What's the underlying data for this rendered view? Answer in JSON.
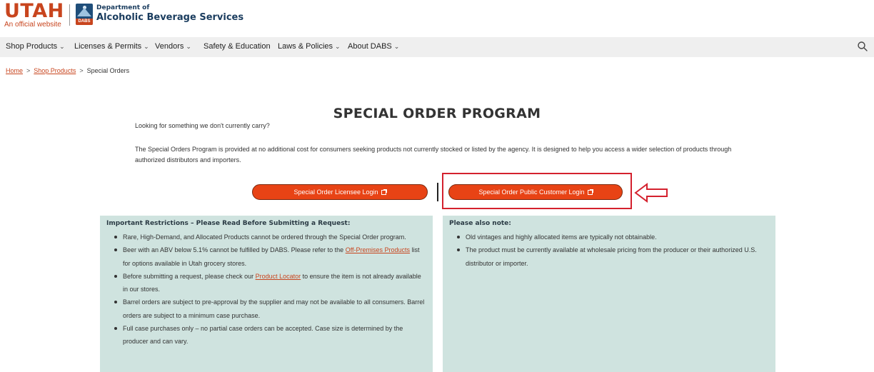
{
  "header": {
    "utah_logo_text": "UTAH",
    "utah_logo_sub": "An official website",
    "dabs_badge_text": "DABS",
    "dept_line1": "Department of",
    "dept_line2": "Alcoholic Beverage Services"
  },
  "nav": {
    "items": [
      {
        "label": "Shop Products",
        "has_dropdown": true
      },
      {
        "label": "Licenses & Permits",
        "has_dropdown": true
      },
      {
        "label": "Vendors",
        "has_dropdown": true
      },
      {
        "label": "Safety & Education",
        "has_dropdown": false
      },
      {
        "label": "Laws & Policies",
        "has_dropdown": true
      },
      {
        "label": "About DABS",
        "has_dropdown": true
      }
    ],
    "search_icon": "search-icon"
  },
  "breadcrumb": {
    "items": [
      "Home",
      "Shop Products",
      "Special Orders"
    ]
  },
  "main": {
    "title": "SPECIAL ORDER PROGRAM",
    "lead": "Looking for something we don't currently carry?",
    "intro": "The Special Orders Program is provided at no additional cost for consumers seeking products not currently stocked or listed by the agency. It is designed to help you access a wider selection of products through authorized distributors and importers."
  },
  "buttons": {
    "licensee_login": "Special Order Licensee Login",
    "public_login": "Special Order Public Customer Login",
    "external_icon": "external-link-icon"
  },
  "annotation": {
    "highlight_color": "#d4212e",
    "arrow_icon": "left-arrow-icon"
  },
  "restrictions": {
    "heading": "Important Restrictions – Please Read Before Submitting a Request:",
    "item1": "Rare, High-Demand, and Allocated Products cannot be ordered through the Special Order program.",
    "item2_before": "Beer with an ABV below 5.1% cannot be fulfilled by DABS. Please refer to the ",
    "item2_link": "Off-Premises Products",
    "item2_after": " list for options available in Utah grocery stores.",
    "item3_before": "Before submitting a request, please check our ",
    "item3_link": "Product Locator",
    "item3_after": " to ensure the item is not already available in our stores.",
    "item4": "Barrel orders are subject to pre-approval by the supplier and may not be available to all consumers. Barrel orders are subject to a minimum case purchase.",
    "item5": "Full case purchases only – no partial case orders can be accepted. Case size is determined by the producer and can vary."
  },
  "notes": {
    "heading": "Please also note:",
    "item1": "Old vintages and highly allocated items are typically not obtainable.",
    "item2": "The product must be currently available at wholesale pricing from the producer or their authorized U.S. distributor or importer."
  },
  "colors": {
    "brand_orange": "#c8451e",
    "button_orange": "#e84315",
    "panel_bg": "#cfe3df",
    "nav_bg": "#efefef",
    "dept_navy": "#1a3c5e"
  }
}
